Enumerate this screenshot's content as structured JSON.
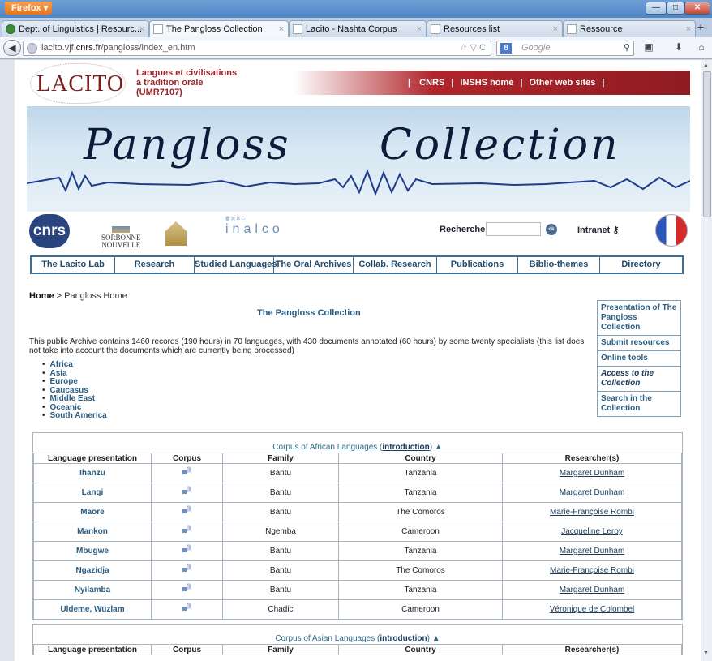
{
  "browser": {
    "app_button": "Firefox",
    "tabs": [
      {
        "label": "Dept. of Linguistics | Resourc...",
        "active": false
      },
      {
        "label": "The Pangloss Collection",
        "active": true
      },
      {
        "label": "Lacito - Nashta Corpus",
        "active": false
      },
      {
        "label": "Resources list",
        "active": false
      },
      {
        "label": "Ressource",
        "active": false
      }
    ],
    "url_prefix": "lacito.vjf.",
    "url_host": "cnrs.fr",
    "url_path": "/pangloss/index_en.htm",
    "search_placeholder": "Google"
  },
  "header": {
    "logo_text": "LACITO",
    "lab_name_line1": "Langues et civilisations",
    "lab_name_line2": "à tradition orale",
    "lab_name_line3": "(UMR7107)",
    "top_links": [
      "CNRS",
      "INSHS home",
      "Other web sites"
    ]
  },
  "banner": {
    "word1": "Pangloss",
    "word2": "Collection"
  },
  "logos": {
    "cnrs": "cnrs",
    "sorbonne_line1": "SORBONNE",
    "sorbonne_line2": "NOUVELLE",
    "inalco": "inalco",
    "search_label": "Rechercher",
    "ok": "ok",
    "intranet": "Intranet"
  },
  "mainnav": [
    "The Lacito Lab",
    "Research",
    "Studied Languages",
    "The Oral Archives",
    "Collab. Research",
    "Publications",
    "Biblio-themes",
    "Directory"
  ],
  "content": {
    "crumb_home": "Home",
    "crumb_sep": " > ",
    "crumb_current": "Pangloss Home",
    "title": "The Pangloss Collection",
    "intro": "This public Archive contains 1460 records (190 hours) in 70 languages, with 430 documents annotated (60 hours) by some twenty specialists (this list does not take into account the documents which are currently being processed)",
    "regions": [
      "Africa",
      "Asia",
      "Europe",
      "Caucasus",
      "Middle East",
      "Oceanic",
      "South America"
    ]
  },
  "sidebar": [
    "Presentation of The Pangloss Collection",
    "Submit resources",
    "Online tools",
    "Access to the Collection",
    "Search in the Collection"
  ],
  "table_headers": [
    "Language presentation",
    "Corpus",
    "Family",
    "Country",
    "Researcher(s)"
  ],
  "africa": {
    "caption_pre": "Corpus of African Languages (",
    "caption_link": "introduction",
    "caption_post": ") ▲",
    "rows": [
      {
        "lang": "Ihanzu",
        "family": "Bantu",
        "country": "Tanzania",
        "researcher": "Margaret Dunham"
      },
      {
        "lang": "Langi",
        "family": "Bantu",
        "country": "Tanzania",
        "researcher": "Margaret Dunham"
      },
      {
        "lang": "Maore",
        "family": "Bantu",
        "country": "The Comoros",
        "researcher": "Marie-Françoise Rombi"
      },
      {
        "lang": "Mankon",
        "family": "Ngemba",
        "country": "Cameroon",
        "researcher": "Jacqueline Leroy"
      },
      {
        "lang": "Mbugwe",
        "family": "Bantu",
        "country": "Tanzania",
        "researcher": "Margaret Dunham"
      },
      {
        "lang": "Ngazidja",
        "family": "Bantu",
        "country": "The Comoros",
        "researcher": "Marie-Françoise Rombi"
      },
      {
        "lang": "Nyilamba",
        "family": "Bantu",
        "country": "Tanzania",
        "researcher": "Margaret Dunham"
      },
      {
        "lang": "Uldeme, Wuzlam",
        "family": "Chadic",
        "country": "Cameroon",
        "researcher": "Véronique de Colombel"
      }
    ]
  },
  "asia": {
    "caption_pre": "Corpus of Asian Languages (",
    "caption_link": "introduction",
    "caption_post": ") ▲"
  }
}
